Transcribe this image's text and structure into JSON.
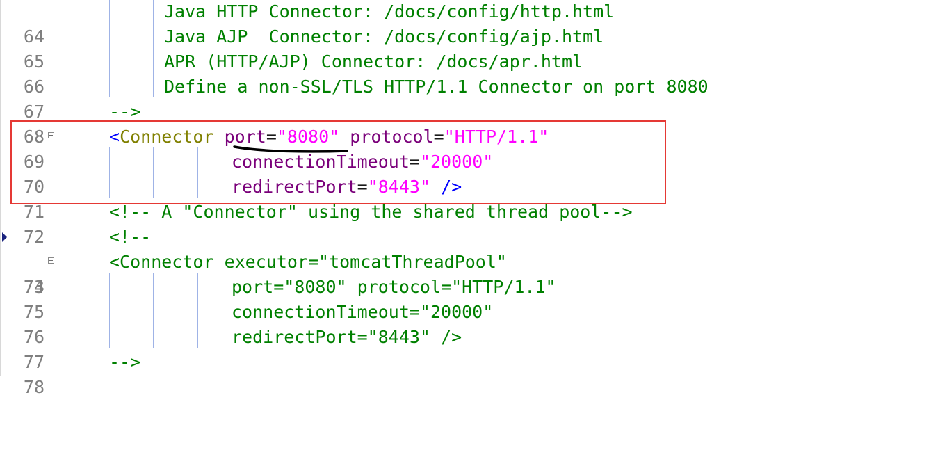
{
  "colors": {
    "comment": "#008000",
    "tag_punct": "#0000ff",
    "tag_name": "#808000",
    "attr": "#7a007a",
    "value": "#ff00ff",
    "line_number": "#7f7f7f",
    "highlight_border": "#e53935"
  },
  "icons": {
    "fold": "collapse-minus-box-icon",
    "bookmark": "bookmark-arrow-icon"
  },
  "lines": [
    {
      "num": "64",
      "text": "Java HTTP Connector: /docs/config/http.html"
    },
    {
      "num": "65",
      "text": "Java AJP  Connector: /docs/config/ajp.html"
    },
    {
      "num": "66",
      "text": "APR (HTTP/AJP) Connector: /docs/apr.html"
    },
    {
      "num": "67",
      "text": "Define a non-SSL/TLS HTTP/1.1 Connector on port 8080"
    },
    {
      "num": "68",
      "text": "-->"
    },
    {
      "num": "69",
      "open": "<",
      "tag": "Connector",
      "attr1": "port",
      "eq1": "=",
      "val1": "\"8080\"",
      "attr2": "protocol",
      "eq2": "=",
      "val2": "\"HTTP/1.1\""
    },
    {
      "num": "70",
      "attr1": "connectionTimeout",
      "eq1": "=",
      "val1": "\"20000\""
    },
    {
      "num": "71",
      "attr1": "redirectPort",
      "eq1": "=",
      "val1": "\"8443\"",
      "close": "/>"
    },
    {
      "num": "72",
      "text": "<!-- A \"Connector\" using the shared thread pool-->"
    },
    {
      "num": "73",
      "text": "<!--"
    },
    {
      "num": "74",
      "text": "<Connector executor=\"tomcatThreadPool\""
    },
    {
      "num": "75",
      "text": "port=\"8080\" protocol=\"HTTP/1.1\""
    },
    {
      "num": "76",
      "text": "connectionTimeout=\"20000\""
    },
    {
      "num": "77",
      "text": "redirectPort=\"8443\" />"
    },
    {
      "num": "78",
      "text": "-->"
    }
  ]
}
